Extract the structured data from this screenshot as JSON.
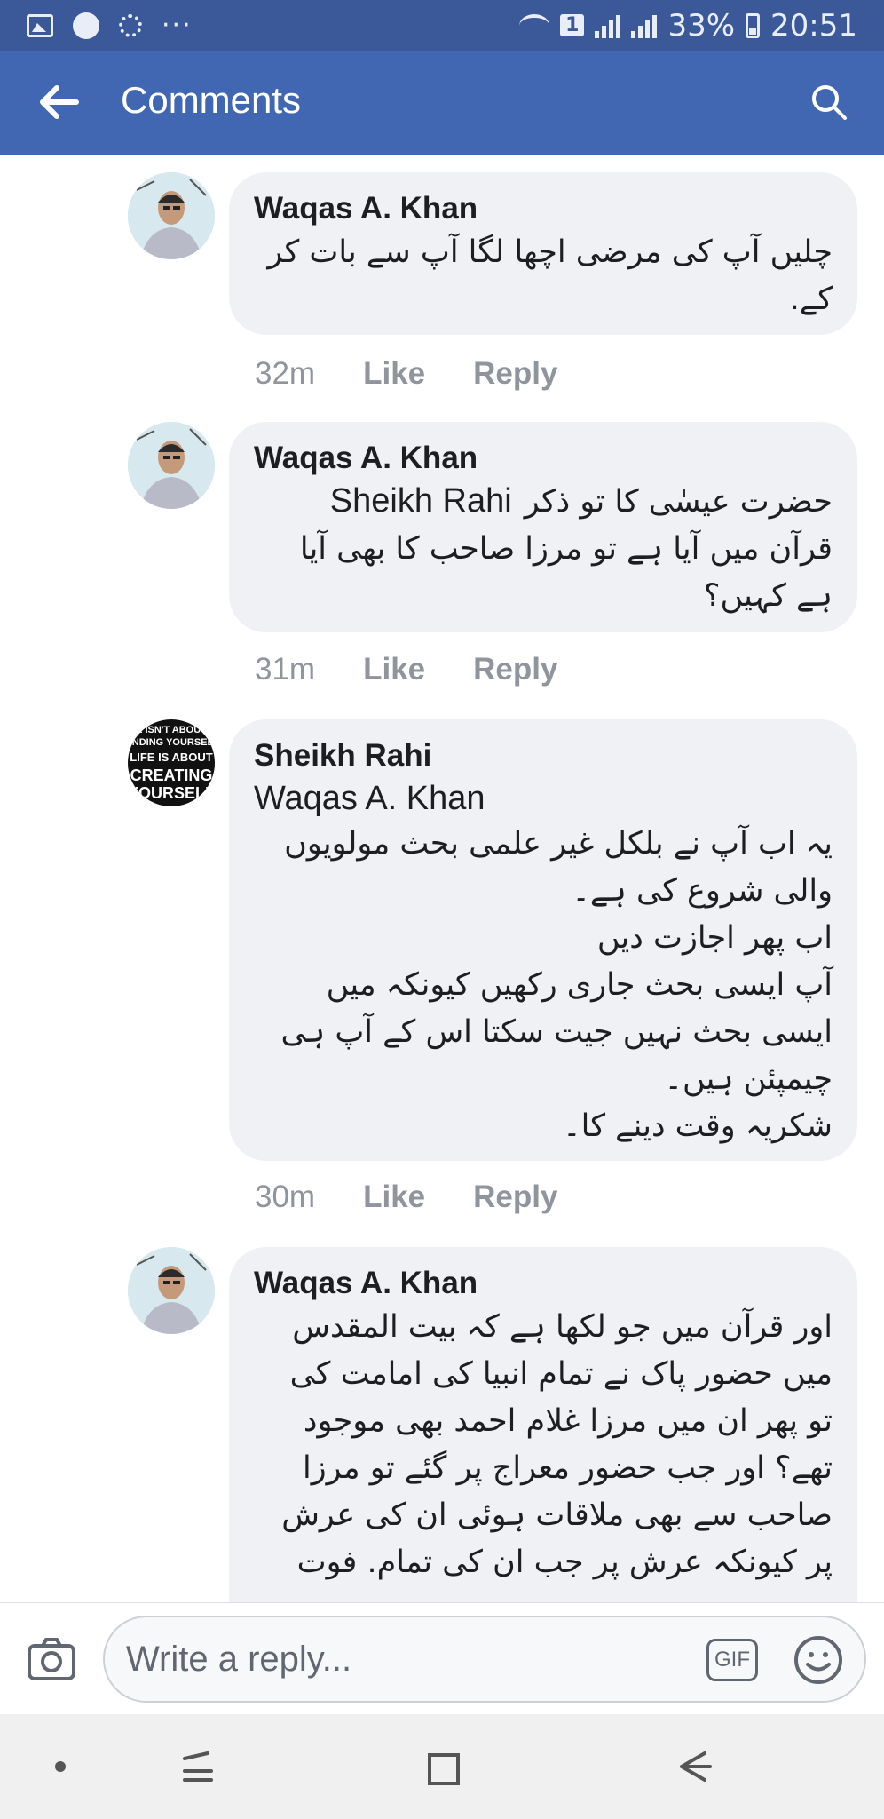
{
  "status_bar": {
    "sim_badge": "1",
    "battery": "33%",
    "time": "20:51",
    "overflow": "···"
  },
  "header": {
    "title": "Comments",
    "back_icon": "arrow-left-icon",
    "search_icon": "search-icon"
  },
  "comments": [
    {
      "author": "Waqas A. Khan",
      "mention": "",
      "text": "چلیں آپ کی مرضی اچھا لگا آپ سے بات کر\nکے.",
      "time": "32m",
      "like": "Like",
      "reply": "Reply"
    },
    {
      "author": "Waqas A. Khan",
      "mention": "Sheikh Rahi",
      "mention_tail": "حضرت عیسٰی کا تو ذکر",
      "text": "قرآن میں آیا ہے تو مرزا صاحب کا بھی آیا\nہے کہیں؟",
      "time": "31m",
      "like": "Like",
      "reply": "Reply"
    },
    {
      "author": "Sheikh Rahi",
      "mention": "Waqas A. Khan",
      "text": "یہ اب آپ نے بلکل غیر علمی بحث مولویوں\nوالی شروع کی ہے۔\nاب پھر اجازت دیں\nآپ ایسی بحث جاری رکھیں کیونکہ میں\nایسی بحث نہیں جیت سکتا اس کے آپ ہی\nچیمپئن ہیں۔\nشکریہ وقت دینے کا۔",
      "time": "30m",
      "like": "Like",
      "reply": "Reply",
      "avatar_text": [
        "E ISN'T ABOUT",
        "FINDING YOURSELF",
        "LIFE IS ABOUT",
        "CREATING",
        "YOURSELF"
      ]
    },
    {
      "author": "Waqas A. Khan",
      "mention": "",
      "text": "اور قرآن میں جو لکھا ہے کہ بیت المقدس\nمیں حضور پاک نے تمام انبیا کی امامت کی\nتو پھر ان میں مرزا غلام احمد بھی موجود\nتھے؟ اور جب حضور معراج پر گئے تو مرزا\nصاحب سے بھی ملاقات ہوئی ان کی عرش\nپر کیونکہ عرش پر جب ان کی تمام. فوت",
      "time": "",
      "like": "",
      "reply": ""
    }
  ],
  "reply_bar": {
    "placeholder": "Write a reply...",
    "gif_label": "GIF",
    "camera_icon": "camera-icon",
    "emoji_icon": "emoji-icon"
  },
  "nav_bar": {
    "icons": [
      "dot-icon",
      "recent-apps-icon",
      "home-icon",
      "back-icon"
    ]
  }
}
